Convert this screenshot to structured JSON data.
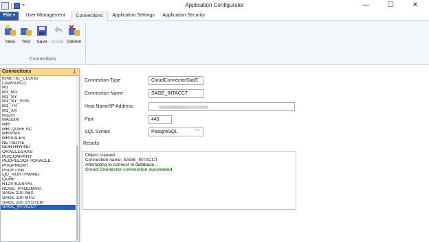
{
  "window": {
    "title": "Application Configurator",
    "minimize": "—",
    "maximize": "☐",
    "close": "✕"
  },
  "qat": {
    "dropdown": "="
  },
  "tabs": [
    {
      "label": "File ▾"
    },
    {
      "label": "User Management"
    },
    {
      "label": "Connections"
    },
    {
      "label": "Application Settings"
    },
    {
      "label": "Application Security"
    }
  ],
  "ribbon": {
    "buttons": [
      {
        "label": "New",
        "icon": "new-icon"
      },
      {
        "label": "Test",
        "icon": "test-icon"
      },
      {
        "label": "Save",
        "icon": "save-icon"
      },
      {
        "label": "Undo",
        "icon": "undo-icon"
      },
      {
        "label": "Delete",
        "icon": "delete-icon"
      }
    ],
    "group_label": "Connections"
  },
  "panel": {
    "header": "Connections",
    "pin": "⊥",
    "items": [
      "KINETIC_CLOUD",
      "LAWSON11",
      "M1",
      "M1_M1",
      "M1_SY",
      "M1_SY_VPN",
      "M1_TR",
      "M1_XX",
      "M1DS",
      "MAS500",
      "MRI",
      "MRI QUBE SC",
      "MRIPMX",
      "MRISALES",
      "NETSUITE",
      "NORTHWIND",
      "ORACLESAAS",
      "PDICOMPANY",
      "PEOPLESOFTORACLE",
      "PROPMGMT",
      "PSOFTVM",
      "QD_NORTHWIND",
      "QUBE",
      "R12VIS2APPS",
      "ROSS_PRODMAN",
      "SAGE 100 ABX",
      "SAGE 100 MFG",
      "SAGE 100 SYSTEM",
      "SAGE_INTACCT"
    ]
  },
  "form": {
    "connection_type_label": "Connection Type",
    "connection_type_value": "CloudConnectorSaaS",
    "connection_name_label": "Connection Name",
    "connection_name_value": "SAGE_INTACCT",
    "host_label": "Host Name/IP Address",
    "port_label": "Port",
    "port_value": "443",
    "sql_syntax_label": "SQL Syntax",
    "sql_syntax_value": "PostgreSQL",
    "results_label": "Results",
    "results_lines": [
      "Object created",
      "Connection name: SAGE_INTACCT",
      "Attempting to connect to database...",
      "Cloud Connector connection succeeded"
    ]
  },
  "colors": {
    "accent": "#2f5a9e",
    "panel_header": "#ffd88a",
    "selected": "#1e5bd6",
    "success": "#1a7f1a"
  }
}
